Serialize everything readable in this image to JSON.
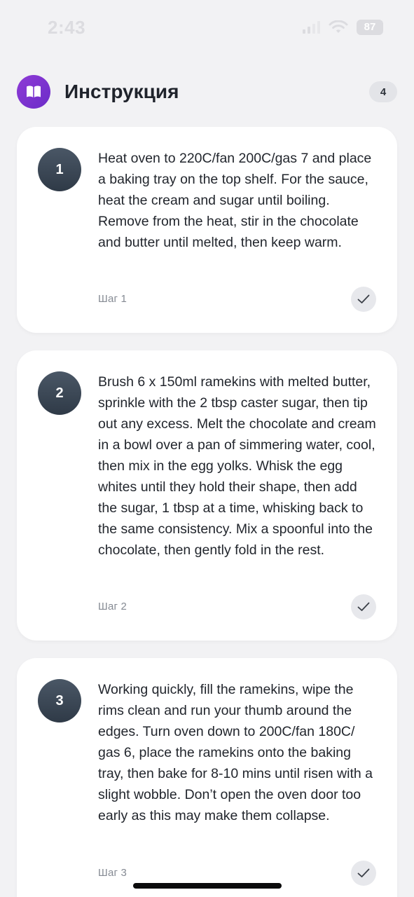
{
  "status_bar": {
    "time": "2:43",
    "battery": "87"
  },
  "header": {
    "icon": "book-icon",
    "title": "Инструкция",
    "count": "4"
  },
  "steps": [
    {
      "number": "1",
      "text": "Heat oven to 220C/fan 200C/gas 7 and place a baking tray on the top shelf. For the sauce, heat the cream and sugar until boiling. Remove from the heat, stir in the chocolate and butter until melted, then keep warm.",
      "label": "Шаг 1"
    },
    {
      "number": "2",
      "text": "Brush 6 x 150ml ramekins with melted butter, sprinkle with the 2 tbsp caster sugar, then tip out any excess. Melt the chocolate and cream in a bowl over a pan of simmering water, cool, then mix in the egg yolks. Whisk the egg whites until they hold their shape, then add the sugar, 1 tbsp at a time, whisking back to the same consistency. Mix a spoonful into the chocolate, then gently fold in the rest.",
      "label": "Шаг 2"
    },
    {
      "number": "3",
      "text": "Working quickly, fill the ramekins, wipe the rims clean and run your thumb around the edges. Turn oven down to 200C/fan 180C/ gas 6, place the ramekins onto the baking tray, then bake for 8-10 mins until risen with a slight wobble. Don’t open the oven door too early as this may make them collapse.",
      "label": "Шаг 3"
    }
  ]
}
